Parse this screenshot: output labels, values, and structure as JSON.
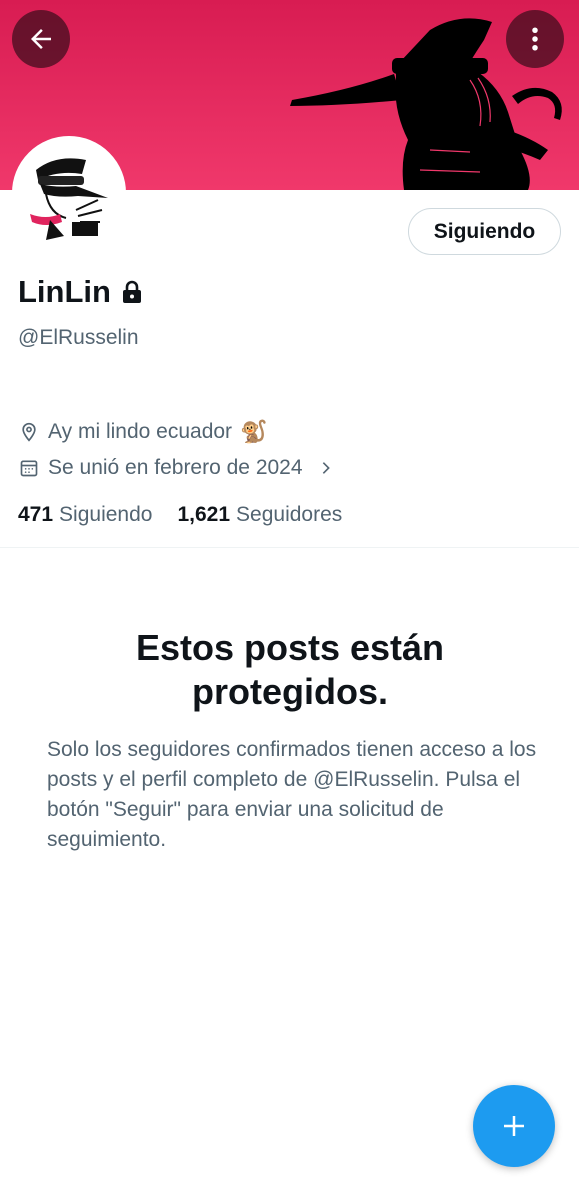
{
  "header": {
    "back_icon": "arrow-left-icon",
    "more_icon": "more-vertical-icon",
    "banner_color": "#e8255b"
  },
  "profile": {
    "display_name": "LinLin",
    "lock_icon": "lock-icon",
    "handle": "@ElRusselin",
    "follow_button_label": "Siguiendo",
    "location": "Ay mi lindo ecuador",
    "location_emoji": "🐒",
    "joined": "Se unió en febrero de 2024",
    "following_count": "471",
    "following_label": "Siguiendo",
    "followers_count": "1,621",
    "followers_label": "Seguidores"
  },
  "protected": {
    "title": "Estos posts están protegidos.",
    "body": "Solo los seguidores confirmados tienen acceso a los posts y el perfil completo de @ElRusselin. Pulsa el botón \"Seguir\" para enviar una solicitud de seguimiento."
  },
  "fab": {
    "icon": "plus-icon",
    "color": "#1d9bf0"
  }
}
